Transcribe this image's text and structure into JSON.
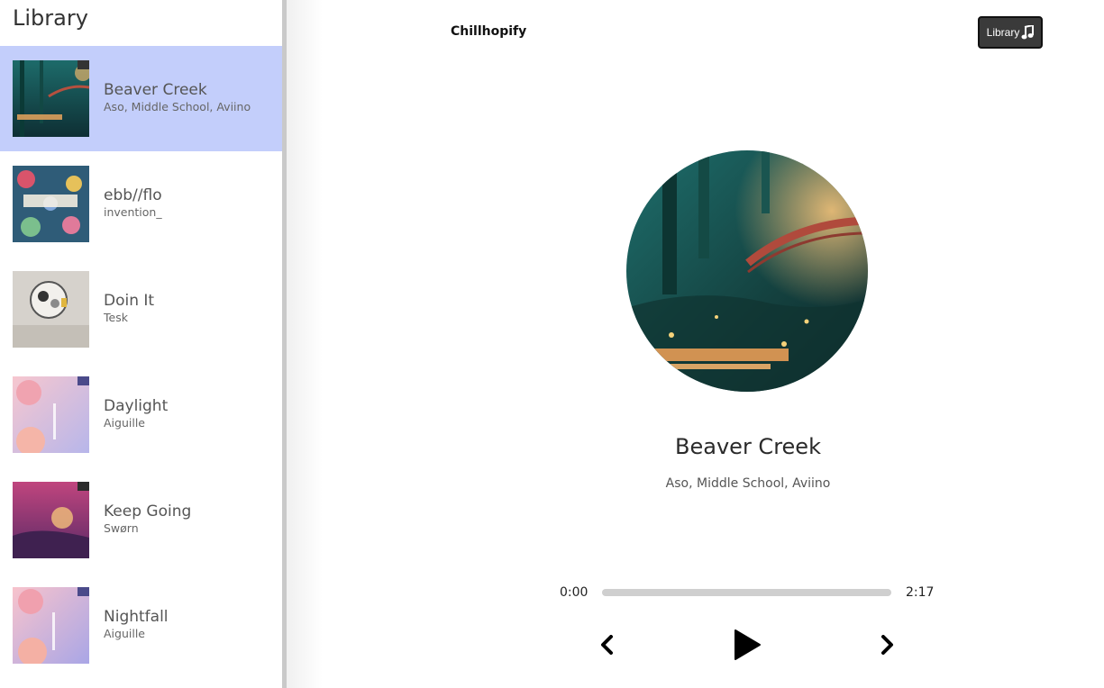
{
  "sidebar": {
    "title": "Library",
    "songs": [
      {
        "name": "Beaver Creek",
        "artist": "Aso, Middle School, Aviino",
        "selected": true
      },
      {
        "name": "ebb//flo",
        "artist": "invention_",
        "selected": false
      },
      {
        "name": "Doin It",
        "artist": "Tesk",
        "selected": false
      },
      {
        "name": "Daylight",
        "artist": "Aiguille",
        "selected": false
      },
      {
        "name": "Keep Going",
        "artist": "Swørn",
        "selected": false
      },
      {
        "name": "Nightfall",
        "artist": "Aiguille",
        "selected": false
      }
    ]
  },
  "nav": {
    "logo": "Chillhopify",
    "library_button": "Library",
    "library_icon": "music-note-icon"
  },
  "player": {
    "title": "Beaver Creek",
    "artist": "Aso, Middle School, Aviino",
    "current_time": "0:00",
    "total_time": "2:17",
    "progress_fraction": 0,
    "prev_icon": "chevron-left-icon",
    "play_icon": "play-icon",
    "next_icon": "chevron-right-icon"
  },
  "colors": {
    "selected_row": "#c3cefb",
    "library_button_bg": "#3a3a3a"
  }
}
